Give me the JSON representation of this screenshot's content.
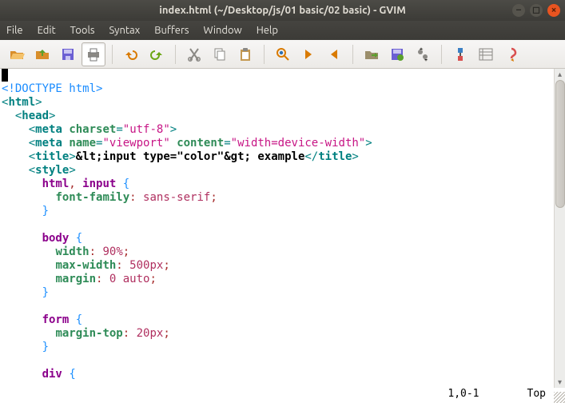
{
  "window": {
    "title": "index.html (~/Desktop/js/01 basic/02 basic) - GVIM"
  },
  "menu": {
    "file": "File",
    "edit": "Edit",
    "tools": "Tools",
    "syntax": "Syntax",
    "buffers": "Buffers",
    "window": "Window",
    "help": "Help"
  },
  "toolbar_icons": [
    "open-icon",
    "save-icon",
    "save-all-icon",
    "print-icon",
    "undo-icon",
    "redo-icon",
    "cut-icon",
    "copy-icon",
    "paste-icon",
    "find-replace-icon",
    "find-next-icon",
    "find-prev-icon",
    "load-session-icon",
    "save-session-icon",
    "run-script-icon",
    "make-icon",
    "shell-icon",
    "help-icon"
  ],
  "status": {
    "pos": "1,0-1",
    "loc": "Top"
  },
  "code": {
    "doctype": "<!DOCTYPE html>",
    "lines": [
      {
        "t": "tag",
        "indent": 0,
        "open": "<",
        "name": "html",
        "close": ">"
      },
      {
        "t": "tag",
        "indent": 1,
        "open": "<",
        "name": "head",
        "close": ">"
      },
      {
        "t": "taga",
        "indent": 2,
        "open": "<",
        "name": "meta",
        "attrs": [
          {
            "k": "charset",
            "v": "\"utf-8\""
          }
        ],
        "close": ">"
      },
      {
        "t": "taga",
        "indent": 2,
        "open": "<",
        "name": "meta",
        "attrs": [
          {
            "k": "name",
            "v": "\"viewport\""
          },
          {
            "k": "content",
            "v": "\"width=device-width\""
          }
        ],
        "close": ">"
      },
      {
        "t": "title",
        "indent": 2,
        "open": "<",
        "name": "title",
        "text": "&lt;input type=\"color\"&gt; example",
        "closeTag": "</",
        "closeName": "title",
        "close2": ">"
      },
      {
        "t": "tag",
        "indent": 2,
        "open": "<",
        "name": "style",
        "close": ">"
      },
      {
        "t": "css-sel",
        "indent": 3,
        "sel": "html, input",
        "brace": "{"
      },
      {
        "t": "css-prop",
        "indent": 4,
        "prop": "font-family",
        "val": "sans-serif"
      },
      {
        "t": "css-brace",
        "indent": 3,
        "brace": "}"
      },
      {
        "t": "blank"
      },
      {
        "t": "css-sel",
        "indent": 3,
        "sel": "body",
        "brace": "{"
      },
      {
        "t": "css-prop",
        "indent": 4,
        "prop": "width",
        "val": "90%"
      },
      {
        "t": "css-prop",
        "indent": 4,
        "prop": "max-width",
        "val": "500px"
      },
      {
        "t": "css-prop",
        "indent": 4,
        "prop": "margin",
        "val": "0 auto"
      },
      {
        "t": "css-brace",
        "indent": 3,
        "brace": "}"
      },
      {
        "t": "blank"
      },
      {
        "t": "css-sel",
        "indent": 3,
        "sel": "form",
        "brace": "{"
      },
      {
        "t": "css-prop",
        "indent": 4,
        "prop": "margin-top",
        "val": "20px"
      },
      {
        "t": "css-brace",
        "indent": 3,
        "brace": "}"
      },
      {
        "t": "blank"
      },
      {
        "t": "css-sel",
        "indent": 3,
        "sel": "div",
        "brace": "{"
      }
    ]
  }
}
